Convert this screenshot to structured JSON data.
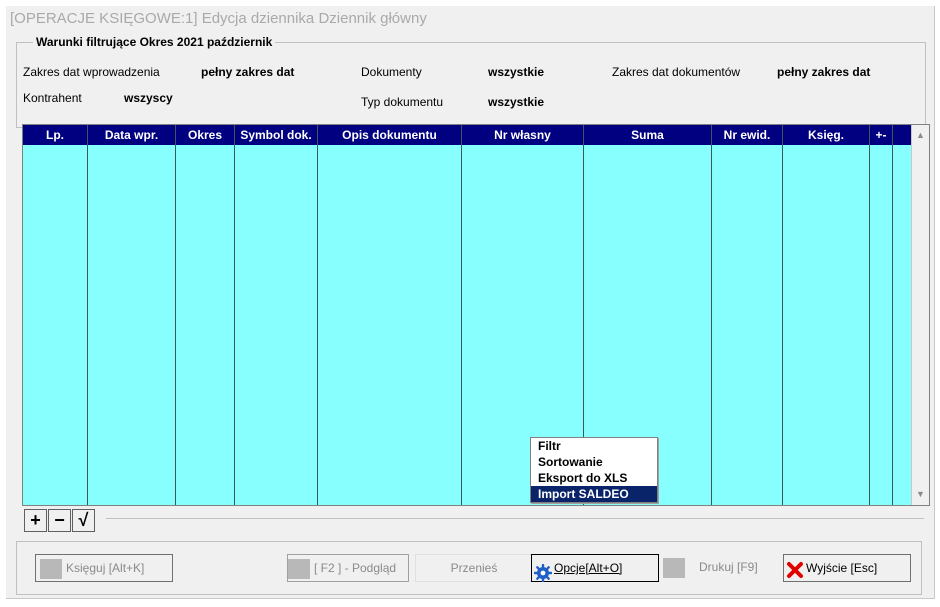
{
  "window": {
    "title": "[OPERACJE KSIĘGOWE:1] Edycja dziennika  Dziennik główny"
  },
  "filters": {
    "legend": "Warunki filtrujące  Okres 2021 październik",
    "entry_date_range_label": "Zakres dat  wprowadzenia",
    "entry_date_range_value": "pełny zakres dat",
    "documents_label": "Dokumenty",
    "documents_value": "wszystkie",
    "doc_date_range_label": "Zakres dat  dokumentów",
    "doc_date_range_value": "pełny zakres dat",
    "contractor_label": "Kontrahent",
    "contractor_value": "wszyscy",
    "doc_type_label": "Typ dokumentu",
    "doc_type_value": "wszystkie"
  },
  "grid": {
    "columns": [
      "Lp.",
      "Data wpr.",
      "Okres",
      "Symbol dok.",
      "Opis dokumentu",
      "Nr własny",
      "Suma",
      "Nr ewid.",
      "Księg.",
      "+-"
    ],
    "rows": []
  },
  "toolbox": {
    "add": "+",
    "remove": "−",
    "apply": "√"
  },
  "context_menu": {
    "items": [
      "Filtr",
      "Sortowanie",
      "Eksport do XLS",
      "Import SALDEO"
    ],
    "selected": "Import SALDEO"
  },
  "buttons": {
    "post": "Księguj [Alt+K]",
    "preview": "[ F2 ] - Podgląd",
    "move": "Przenieś",
    "options": "Opcje[Alt+O]",
    "print": "Drukuj  [F9]",
    "exit": "Wyjście  [Esc]"
  },
  "colors": {
    "grid_header": "#000080",
    "grid_body": "#87ffff",
    "menu_selected": "#0a246a",
    "exit_icon": "#e00000",
    "options_icon": "#1e5fc8"
  }
}
